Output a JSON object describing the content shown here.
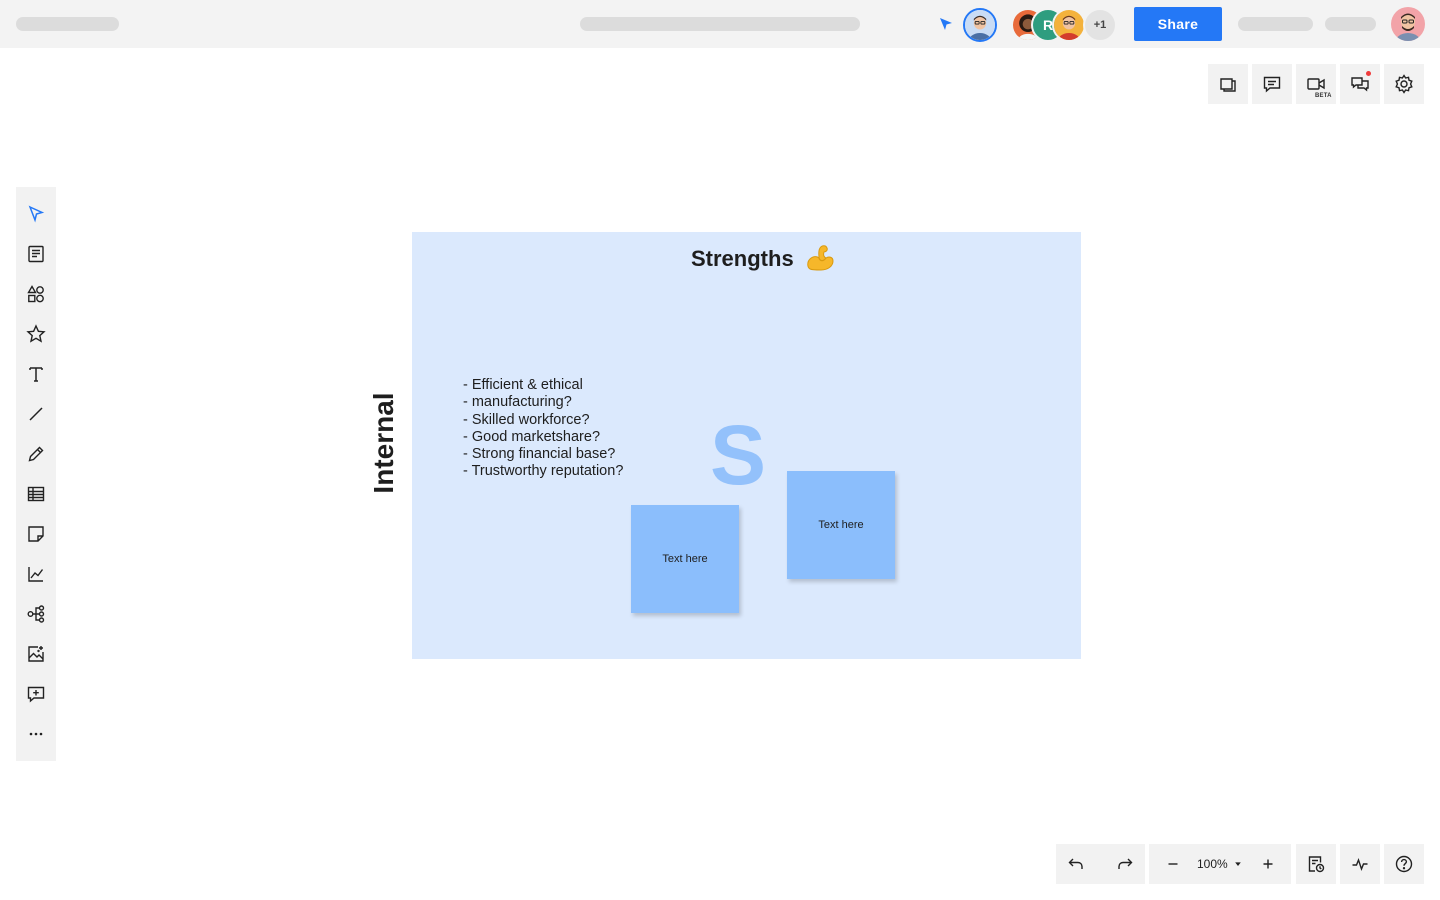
{
  "header": {
    "share_label": "Share",
    "collaborator_letter": "R",
    "collaborator_more": "+1"
  },
  "right_toolbar": {
    "beta_badge": "BETA"
  },
  "board": {
    "title": "Strengths",
    "side_label": "Internal",
    "bullets": [
      "- Efficient & ethical",
      "- manufacturing?",
      "- Skilled workforce?",
      "- Good marketshare?",
      "- Strong financial base?",
      "- Trustworthy reputation?"
    ],
    "big_letter": "S",
    "sticky_notes": [
      {
        "text": "Text here"
      },
      {
        "text": "Text here"
      }
    ]
  },
  "bottom_bar": {
    "zoom_level": "100%"
  },
  "colors": {
    "accent": "#2478f6",
    "panel_background": "#dbe9fd",
    "sticky_note": "#8bbefc",
    "big_letter": "#93c1fb",
    "toolbar_background": "#f2f2f2"
  }
}
